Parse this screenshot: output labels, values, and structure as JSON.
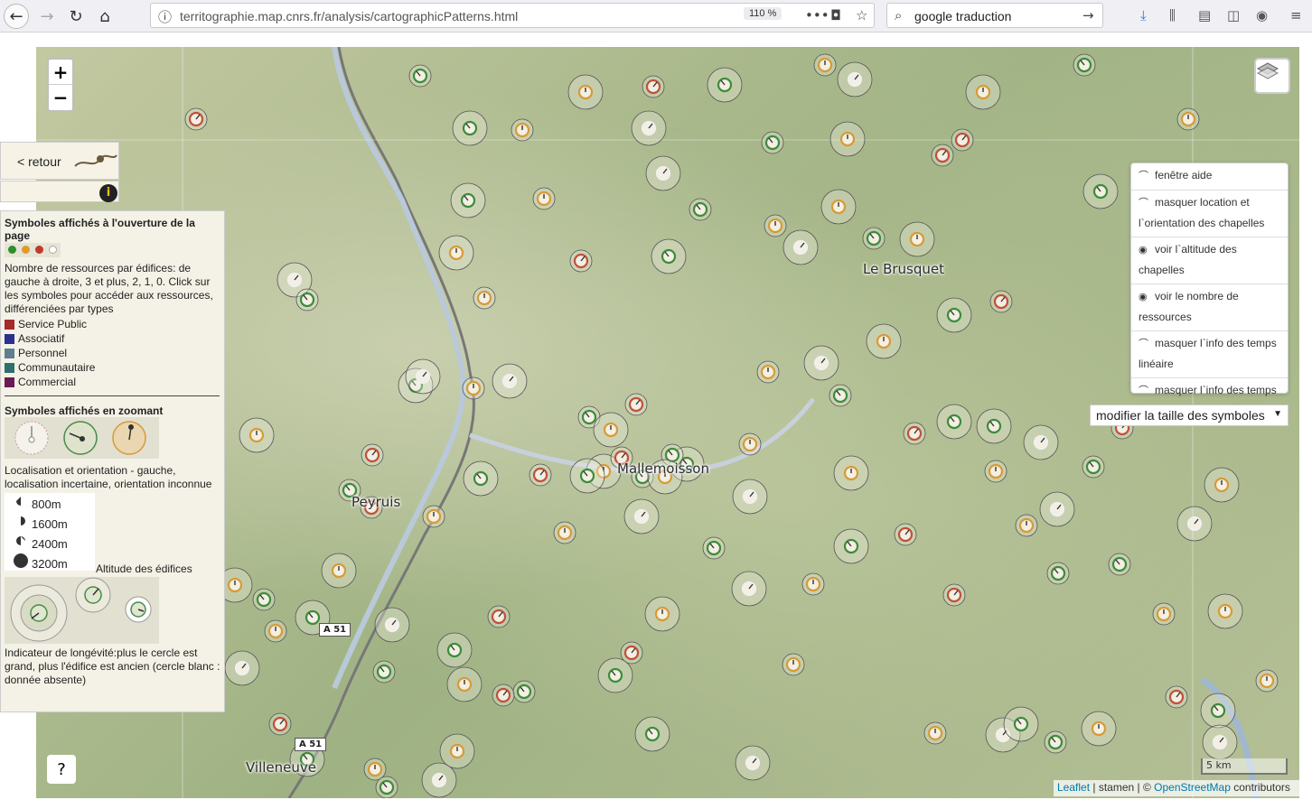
{
  "browser": {
    "url": "territographie.map.cnrs.fr/analysis/cartographicPatterns.html",
    "zoom": "110 %",
    "search_text": "google traduction"
  },
  "map": {
    "zoom_in": "+",
    "zoom_out": "−",
    "places": [
      "Le Brusquet",
      "Mallemoisson",
      "Peyruis",
      "Villeneuve"
    ],
    "road_labels": [
      "A 51",
      "A 51"
    ],
    "scale": "5 km",
    "attribution": {
      "leaflet": "Leaflet",
      "stamen": "| stamen | ©",
      "osm": "OpenStreetMap",
      "tail": "contributors"
    },
    "help": "?",
    "marker_colors": {
      "green": "#3d8b3d",
      "orange": "#d79a38",
      "red": "#c0503c",
      "white": "#f0f0f0"
    }
  },
  "left_panel": {
    "retour": "< retour",
    "info": "i",
    "heading_open": "Symboles affichés à l'ouverture de la page",
    "resources_text": "Nombre de ressources par édifices: de gauche à droite, 3 et plus, 2, 1, 0. Click sur les symboles pour accéder aux ressources, différenciées par types",
    "types": [
      {
        "label": "Service Public",
        "color": "#a52a2a"
      },
      {
        "label": "Associatif",
        "color": "#2c2f8f"
      },
      {
        "label": "Personnel",
        "color": "#5f7f8f"
      },
      {
        "label": "Communautaire",
        "color": "#2f6f6f"
      },
      {
        "label": "Commercial",
        "color": "#6b1a55"
      }
    ],
    "heading_zoom": "Symboles affichés en zoomant",
    "localisation_text": "Localisation et orientation - gauche, localisation incertaine, orientation inconnue",
    "altitudes": [
      "800m",
      "1600m",
      "2400m",
      "3200m"
    ],
    "altitude_label": "Altitude des édifices",
    "longevity_text": "Indicateur de longévité:plus le cercle est grand, plus l'édifice est ancien (cercle blanc : donnée absente)"
  },
  "menu": {
    "items": [
      {
        "label": "fenêtre aide",
        "icon": "eye-closed-icon"
      },
      {
        "label": "masquer location et l`orientation des chapelles",
        "icon": "eye-closed-icon"
      },
      {
        "label": "voir l`altitude des chapelles",
        "icon": "eye-open-icon"
      },
      {
        "label": "voir le nombre de ressources",
        "icon": "eye-open-icon"
      },
      {
        "label": "masquer l`info des temps linéaire",
        "icon": "eye-closed-icon"
      },
      {
        "label": "masquer l`info des temps cyclique",
        "icon": "eye-closed-icon"
      }
    ],
    "size_select": "modifier la taille des symboles"
  }
}
